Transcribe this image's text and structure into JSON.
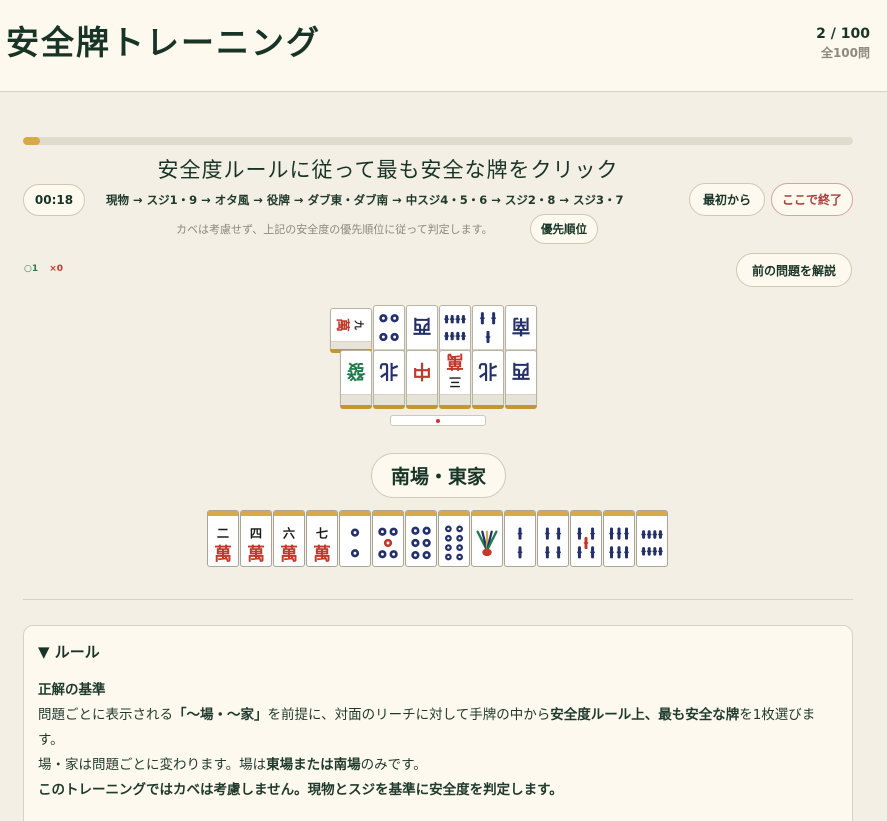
{
  "header": {
    "title": "安全牌トレーニング",
    "counter": "2 / 100",
    "total": "全100問"
  },
  "progress": {
    "current": 2,
    "total": 100
  },
  "question": {
    "title": "安全度ルールに従って最も安全な牌をクリック"
  },
  "timer": "00:18",
  "priority_rule": "現物 → スジ1・9 → オタ風 → 役牌 → ダブ東・ダブ南 → 中スジ4・5・6 → スジ2・8 → スジ3・7",
  "note": "カベは考慮せず、上記の安全度の優先順位に従って判定します。",
  "buttons": {
    "restart": "最初から",
    "end": "ここで終了",
    "priority": "優先順位",
    "prev": "前の問題を解説"
  },
  "score": {
    "correct": "○1",
    "wrong": "×0"
  },
  "discards": {
    "row1": [
      {
        "suit": "man",
        "rank": 9,
        "sideways": true
      },
      {
        "suit": "pin",
        "rank": 4
      },
      {
        "suit": "wind",
        "name": "west"
      },
      {
        "suit": "sou",
        "rank": 8
      },
      {
        "suit": "sou",
        "rank": 3
      },
      {
        "suit": "wind",
        "name": "south"
      }
    ],
    "row2": [
      {
        "suit": "dragon",
        "name": "hatsu"
      },
      {
        "suit": "wind",
        "name": "north"
      },
      {
        "suit": "dragon",
        "name": "chun"
      },
      {
        "suit": "man",
        "rank": 3
      },
      {
        "suit": "wind",
        "name": "north"
      },
      {
        "suit": "wind",
        "name": "west"
      }
    ]
  },
  "round": "南場・東家",
  "hand": [
    {
      "suit": "man",
      "rank": 2
    },
    {
      "suit": "man",
      "rank": 4
    },
    {
      "suit": "man",
      "rank": 6
    },
    {
      "suit": "man",
      "rank": 7
    },
    {
      "suit": "pin",
      "rank": 2
    },
    {
      "suit": "pin",
      "rank": 5
    },
    {
      "suit": "pin",
      "rank": 6
    },
    {
      "suit": "pin",
      "rank": 8
    },
    {
      "suit": "sou",
      "rank": 1
    },
    {
      "suit": "sou",
      "rank": 2
    },
    {
      "suit": "sou",
      "rank": 4
    },
    {
      "suit": "sou",
      "rank": 5
    },
    {
      "suit": "sou",
      "rank": 6
    },
    {
      "suit": "sou",
      "rank": 8
    }
  ],
  "rules": {
    "heading": "▼ ルール",
    "criteria_title": "正解の基準",
    "line1_a": "問題ごとに表示される",
    "line1_b": "「〜場・〜家」",
    "line1_c": "を前提に、対面のリーチに対して手牌の中から",
    "line1_d": "安全度ルール上、最も安全な牌",
    "line1_e": "を1枚選びます。",
    "line2_a": "場・家は問題ごとに変わります。場は",
    "line2_b": "東場または南場",
    "line2_c": "のみです。",
    "line3": "このトレーニングではカベは考慮しません。現物とスジを基準に安全度を判定します。"
  },
  "colors": {
    "accent": "#d9a84a",
    "tile_back": "#c5962f",
    "pin_blue": "#24306b",
    "red": "#c0392b",
    "green": "#1f7a4a",
    "text": "#183427"
  }
}
